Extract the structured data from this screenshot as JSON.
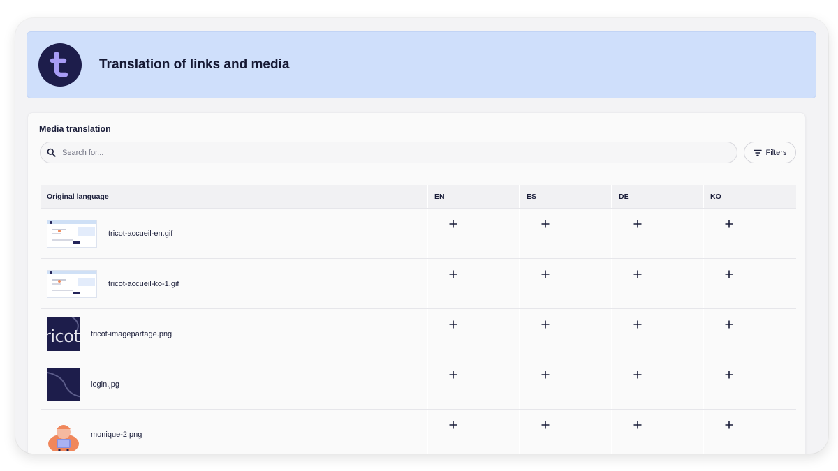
{
  "header": {
    "logo_letter": "t",
    "title": "Translation of links and media"
  },
  "panel": {
    "title": "Media translation",
    "search": {
      "placeholder": "Search for..."
    },
    "filters_label": "Filters"
  },
  "table": {
    "columns": [
      "Original language",
      "EN",
      "ES",
      "DE",
      "KO"
    ],
    "rows": [
      {
        "file": "tricot-accueil-en.gif",
        "thumb": "screenshot"
      },
      {
        "file": "tricot-accueil-ko-1.gif",
        "thumb": "screenshot"
      },
      {
        "file": "tricot-imagepartage.png",
        "thumb": "dark-text",
        "thumb_text": "ricot"
      },
      {
        "file": "login.jpg",
        "thumb": "dark-wave"
      },
      {
        "file": "monique-2.png",
        "thumb": "avatar"
      }
    ],
    "add_icon": "plus-icon"
  },
  "colors": {
    "header_bg": "#cfdffb",
    "logo_bg": "#1d1d4b",
    "logo_letter": "#a89cf6",
    "text": "#1b1e3a"
  }
}
